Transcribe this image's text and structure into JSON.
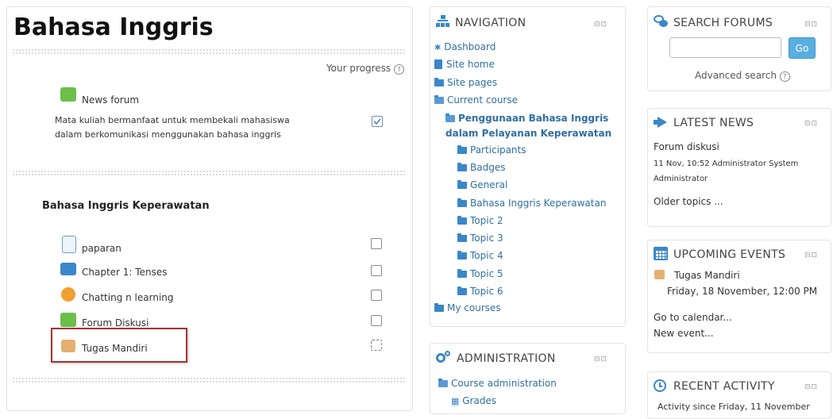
{
  "course": {
    "title": "Bahasa Inggris",
    "progress_label": "Your progress",
    "news_forum": "News forum",
    "description_line1": "Mata kuliah bermanfaat untuk membekali mahasiswa",
    "description_line2": "dalam berkomunikasi menggunakan bahasa inggris",
    "section_title": "Bahasa Inggris Keperawatan",
    "activities": [
      {
        "label": "paparan",
        "icon": "file-icon"
      },
      {
        "label": "Chapter 1: Tenses",
        "icon": "folder-icon"
      },
      {
        "label": "Chatting n learning",
        "icon": "chat-icon"
      },
      {
        "label": "Forum Diskusi",
        "icon": "forum-icon"
      },
      {
        "label": "Tugas Mandiri",
        "icon": "assignment-icon"
      }
    ]
  },
  "navigation": {
    "title": "NAVIGATION",
    "dashboard": "Dashboard",
    "site_home": "Site home",
    "site_pages": "Site pages",
    "current_course": "Current course",
    "course_name_line1": "Penggunaan Bahasa Inggris",
    "course_name_line2": "dalam Pelayanan Keperawatan",
    "course_items": [
      "Participants",
      "Badges",
      "General",
      "Bahasa Inggris Keperawatan",
      "Topic 2",
      "Topic 3",
      "Topic 4",
      "Topic 5",
      "Topic 6"
    ],
    "my_courses": "My courses"
  },
  "administration": {
    "title": "ADMINISTRATION",
    "course_admin": "Course administration",
    "grades": "Grades"
  },
  "search_forums": {
    "title": "SEARCH FORUMS",
    "go_label": "Go",
    "input_value": "",
    "advanced": "Advanced search"
  },
  "latest_news": {
    "title": "LATEST NEWS",
    "item_title": "Forum diskusi",
    "item_meta_line1": "11 Nov, 10:52 Administrator System",
    "item_meta_line2": "Administrator",
    "older": "Older topics ..."
  },
  "upcoming_events": {
    "title": "UPCOMING EVENTS",
    "event_name": "Tugas Mandiri",
    "event_date": "Friday, 18 November, 12:00 PM",
    "calendar_link": "Go to calendar...",
    "new_event": "New event..."
  },
  "recent_activity": {
    "title": "RECENT ACTIVITY",
    "since": "Activity since Friday, 11 November"
  },
  "colors": {
    "link_blue": "#2f6fa3",
    "icon_blue": "#3a87c8",
    "highlight_red": "#a83232",
    "go_button": "#5aaee0"
  }
}
